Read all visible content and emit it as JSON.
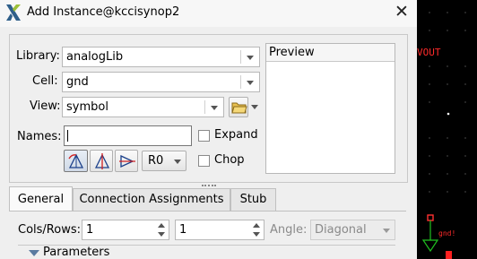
{
  "window": {
    "title": "Add Instance@kccisynop2"
  },
  "form": {
    "library": {
      "label": "Library:",
      "value": "analogLib"
    },
    "cell": {
      "label": "Cell:",
      "value": "gnd"
    },
    "view": {
      "label": "View:",
      "value": "symbol"
    },
    "names": {
      "label": "Names:",
      "value": ""
    },
    "expand_label": "Expand",
    "chop_label": "Chop",
    "rotation": "R0"
  },
  "preview": {
    "title": "Preview"
  },
  "tabs": [
    {
      "label": "General",
      "active": true
    },
    {
      "label": "Connection Assignments",
      "active": false
    },
    {
      "label": "Stub",
      "active": false
    }
  ],
  "general": {
    "cols_rows_label": "Cols/Rows:",
    "cols": "1",
    "rows": "1",
    "angle_label": "Angle:",
    "angle_value": "Diagonal",
    "parameters_label": "Parameters"
  },
  "canvas": {
    "net_label": "VOUT",
    "gnd_label": "gnd!",
    "label_color": "#ff2a2a"
  }
}
